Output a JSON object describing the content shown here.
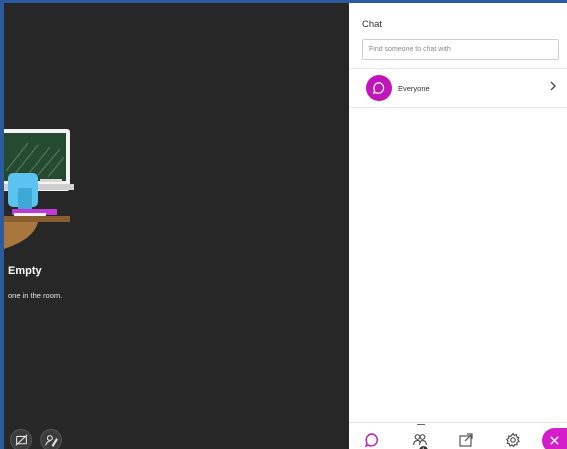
{
  "stage": {
    "empty_title": "Empty",
    "empty_subtitle": "one in the room.",
    "buttons": [
      {
        "icon": "screen-share-off-icon"
      },
      {
        "icon": "edit-profile-icon"
      }
    ]
  },
  "chat": {
    "title": "Chat",
    "search_placeholder": "Find someone to chat with",
    "conversations": [
      {
        "label": "Everyone",
        "icon": "chat-bubble-icon",
        "color": "#c016b9"
      }
    ]
  },
  "tabs": {
    "items": [
      {
        "name": "chat",
        "icon": "chat-bubble-icon",
        "active": true
      },
      {
        "name": "attendees",
        "icon": "people-icon",
        "badge": "1"
      },
      {
        "name": "share-content",
        "icon": "share-icon"
      },
      {
        "name": "settings",
        "icon": "gear-icon"
      },
      {
        "name": "close",
        "icon": "close-icon"
      }
    ],
    "active_color": "#c016b9",
    "close_color": "#d31fc9"
  }
}
